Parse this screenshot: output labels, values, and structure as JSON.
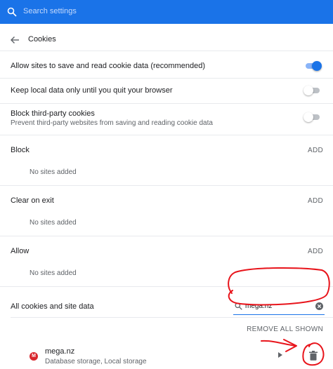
{
  "header": {
    "search_placeholder": "Search settings",
    "color": "#1a73e8"
  },
  "page": {
    "title": "Cookies",
    "back_icon": "arrow-back-icon"
  },
  "settings": {
    "allow_sites": {
      "label": "Allow sites to save and read cookie data (recommended)",
      "enabled": true
    },
    "keep_local": {
      "label": "Keep local data only until you quit your browser",
      "enabled": false
    },
    "block_third_party": {
      "label": "Block third-party cookies",
      "description": "Prevent third-party websites from saving and reading cookie data",
      "enabled": false
    }
  },
  "sections": {
    "block": {
      "title": "Block",
      "add_label": "ADD",
      "empty_text": "No sites added"
    },
    "clear_on_exit": {
      "title": "Clear on exit",
      "add_label": "ADD",
      "empty_text": "No sites added"
    },
    "allow": {
      "title": "Allow",
      "add_label": "ADD",
      "empty_text": "No sites added"
    }
  },
  "site_data": {
    "title": "All cookies and site data",
    "search_value": "mega.nz",
    "remove_all_label": "REMOVE ALL SHOWN",
    "sites": [
      {
        "name": "mega.nz",
        "details": "Database storage, Local storage",
        "icon_letter": "M",
        "icon_color": "#d9272e"
      }
    ]
  },
  "annotation_color": "#e8141b"
}
